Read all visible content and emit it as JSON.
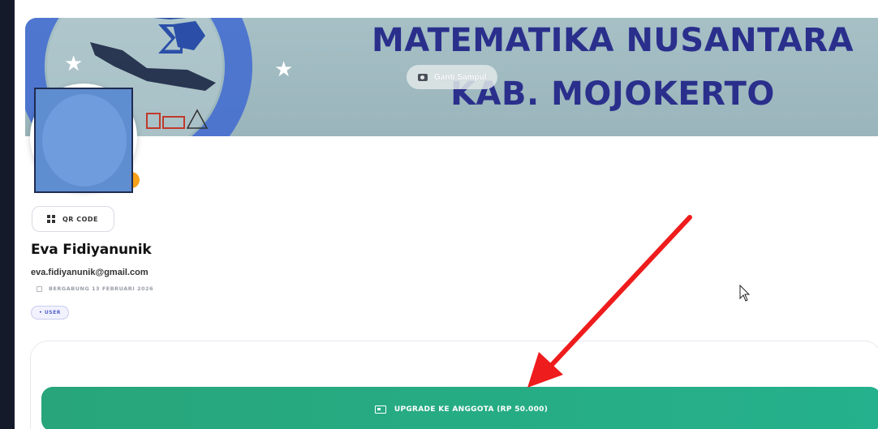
{
  "cover": {
    "title_line1": "MATEMATIKA NUSANTARA",
    "title_line2": "KAB. MOJOKERTO",
    "change_cover_label": "Ganti Sampul",
    "camera_icon": "camera-icon"
  },
  "profile": {
    "qr_label": "QR CODE",
    "qr_icon": "qr-code-icon",
    "name": "Eva Fidiyanunik",
    "email": "eva.fidiyanunik@gmail.com",
    "joined": "BERGABUNG 13 FEBRUARI 2026",
    "calendar_icon": "calendar-icon",
    "role": "• USER"
  },
  "upgrade": {
    "label": "UPGRADE KE ANGGOTA (RP 50.000)",
    "icon": "id-card-icon",
    "color": "#26ad85"
  },
  "annotation": {
    "arrow_color": "#ee1c1c"
  }
}
